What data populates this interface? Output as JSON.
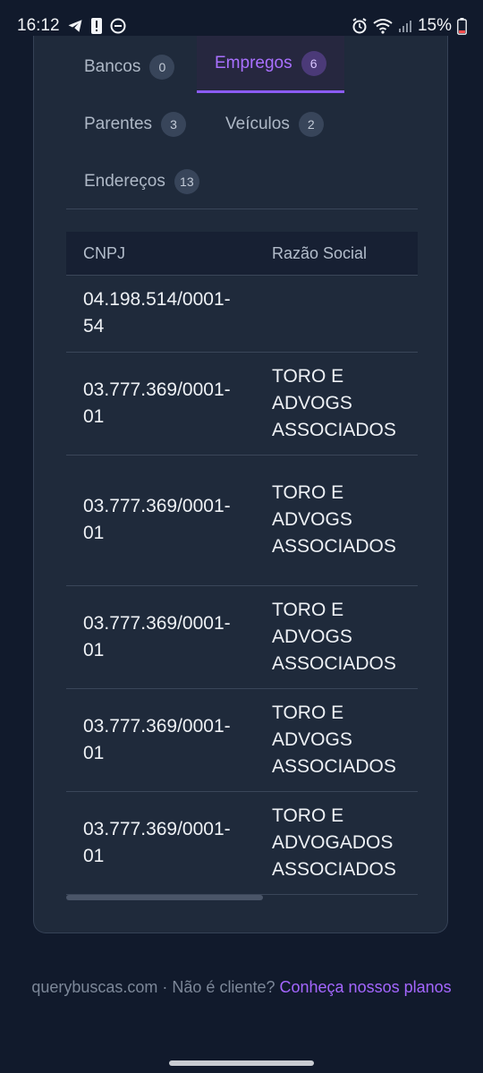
{
  "status_bar": {
    "time": "16:12",
    "battery": "15%",
    "icons_left": [
      "telegram-icon",
      "alert-icon",
      "do-not-disturb-icon"
    ],
    "icons_right": [
      "alarm-icon",
      "wifi-icon",
      "signal-icon",
      "battery-icon"
    ]
  },
  "tabs": [
    {
      "label": "Bancos",
      "count": "0",
      "active": false
    },
    {
      "label": "Empregos",
      "count": "6",
      "active": true
    },
    {
      "label": "Parentes",
      "count": "3",
      "active": false
    },
    {
      "label": "Veículos",
      "count": "2",
      "active": false
    },
    {
      "label": "Endereços",
      "count": "13",
      "active": false
    }
  ],
  "table": {
    "columns": [
      "CNPJ",
      "Razão Social"
    ],
    "rows": [
      {
        "cnpj": [
          "04.198.514/0001-",
          "54"
        ],
        "razao": []
      },
      {
        "cnpj": [
          "03.777.369/0001-",
          "01"
        ],
        "razao": [
          "TORO E",
          "ADVOGS",
          "ASSOCIADOS"
        ]
      },
      {
        "cnpj": [
          "03.777.369/0001-",
          "01"
        ],
        "razao": [
          "TORO E",
          "ADVOGS",
          "ASSOCIADOS"
        ]
      },
      {
        "cnpj": [
          "03.777.369/0001-",
          "01"
        ],
        "razao": [
          "TORO E",
          "ADVOGS",
          "ASSOCIADOS"
        ]
      },
      {
        "cnpj": [
          "03.777.369/0001-",
          "01"
        ],
        "razao": [
          "TORO E",
          "ADVOGS",
          "ASSOCIADOS"
        ]
      },
      {
        "cnpj": [
          "03.777.369/0001-",
          "01"
        ],
        "razao": [
          "TORO E",
          "ADVOGADOS",
          "ASSOCIADOS"
        ]
      }
    ]
  },
  "footer": {
    "site": "querybuscas.com · Não é cliente?",
    "link": "Conheça nossos planos"
  },
  "colors": {
    "background": "#111a2c",
    "card": "#1f2a3b",
    "accent": "#a970ff"
  }
}
